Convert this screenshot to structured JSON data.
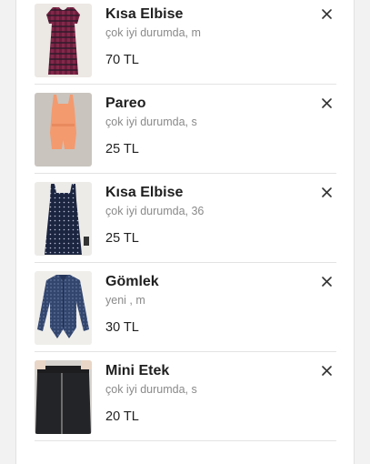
{
  "colors": {
    "background": "#f2f2f2",
    "card": "#ffffff",
    "title": "#1f1f1f",
    "meta": "#8a8a8a",
    "separator": "#e3e3e3"
  },
  "cart": {
    "items": [
      {
        "title": "Kısa Elbise",
        "meta": "çok iyi durumda, m",
        "price": "70 TL",
        "image": "plaid-dress-photo",
        "remove_icon": "close-icon"
      },
      {
        "title": "Pareo",
        "meta": "çok iyi durumda, s",
        "price": "25 TL",
        "image": "orange-romper-photo",
        "remove_icon": "close-icon"
      },
      {
        "title": "Kısa Elbise",
        "meta": "çok iyi durumda, 36",
        "price": "25 TL",
        "image": "navy-polka-dress-photo",
        "remove_icon": "close-icon"
      },
      {
        "title": "Gömlek",
        "meta": "yeni , m",
        "price": "30 TL",
        "image": "denim-shirt-photo",
        "remove_icon": "close-icon"
      },
      {
        "title": "Mini Etek",
        "meta": "çok iyi durumda, s",
        "price": "20 TL",
        "image": "black-mini-skirt-photo",
        "remove_icon": "close-icon"
      }
    ]
  }
}
